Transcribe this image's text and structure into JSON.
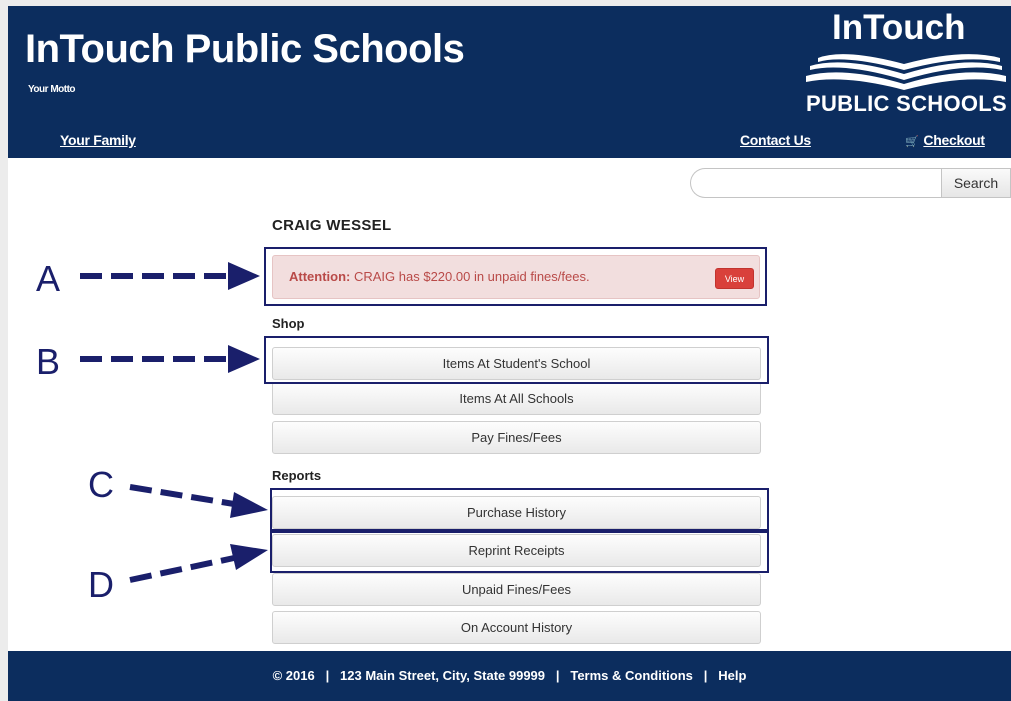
{
  "header": {
    "site_title": "InTouch Public Schools",
    "motto": "Your Motto",
    "logo_top": "InTouch",
    "logo_bottom": "PUBLIC SCHOOLS"
  },
  "nav": {
    "your_family": "Your Family",
    "contact_us": "Contact Us",
    "checkout": "Checkout"
  },
  "search": {
    "placeholder": "",
    "button_label": "Search"
  },
  "student": {
    "name": "CRAIG WESSEL"
  },
  "alert": {
    "label": "Attention:",
    "message": " CRAIG has $220.00 in unpaid fines/fees.",
    "view_label": "View"
  },
  "shop": {
    "label": "Shop",
    "items": [
      "Items At Student's School",
      "Items At All Schools",
      "Pay Fines/Fees"
    ]
  },
  "reports": {
    "label": "Reports",
    "items": [
      "Purchase History",
      "Reprint Receipts",
      "Unpaid Fines/Fees",
      "On Account History"
    ]
  },
  "annotations": {
    "letters": [
      "A",
      "B",
      "C",
      "D"
    ],
    "color": "#1a1f6b"
  },
  "footer": {
    "copyright": "© 2016",
    "separator": "|",
    "address": "123 Main Street, City, State 99999",
    "terms": "Terms & Conditions",
    "help": "Help"
  },
  "colors": {
    "header_bg": "#0c2d5e",
    "alert_bg": "#f2dede",
    "alert_text": "#b94a48",
    "view_button": "#d9403b"
  }
}
